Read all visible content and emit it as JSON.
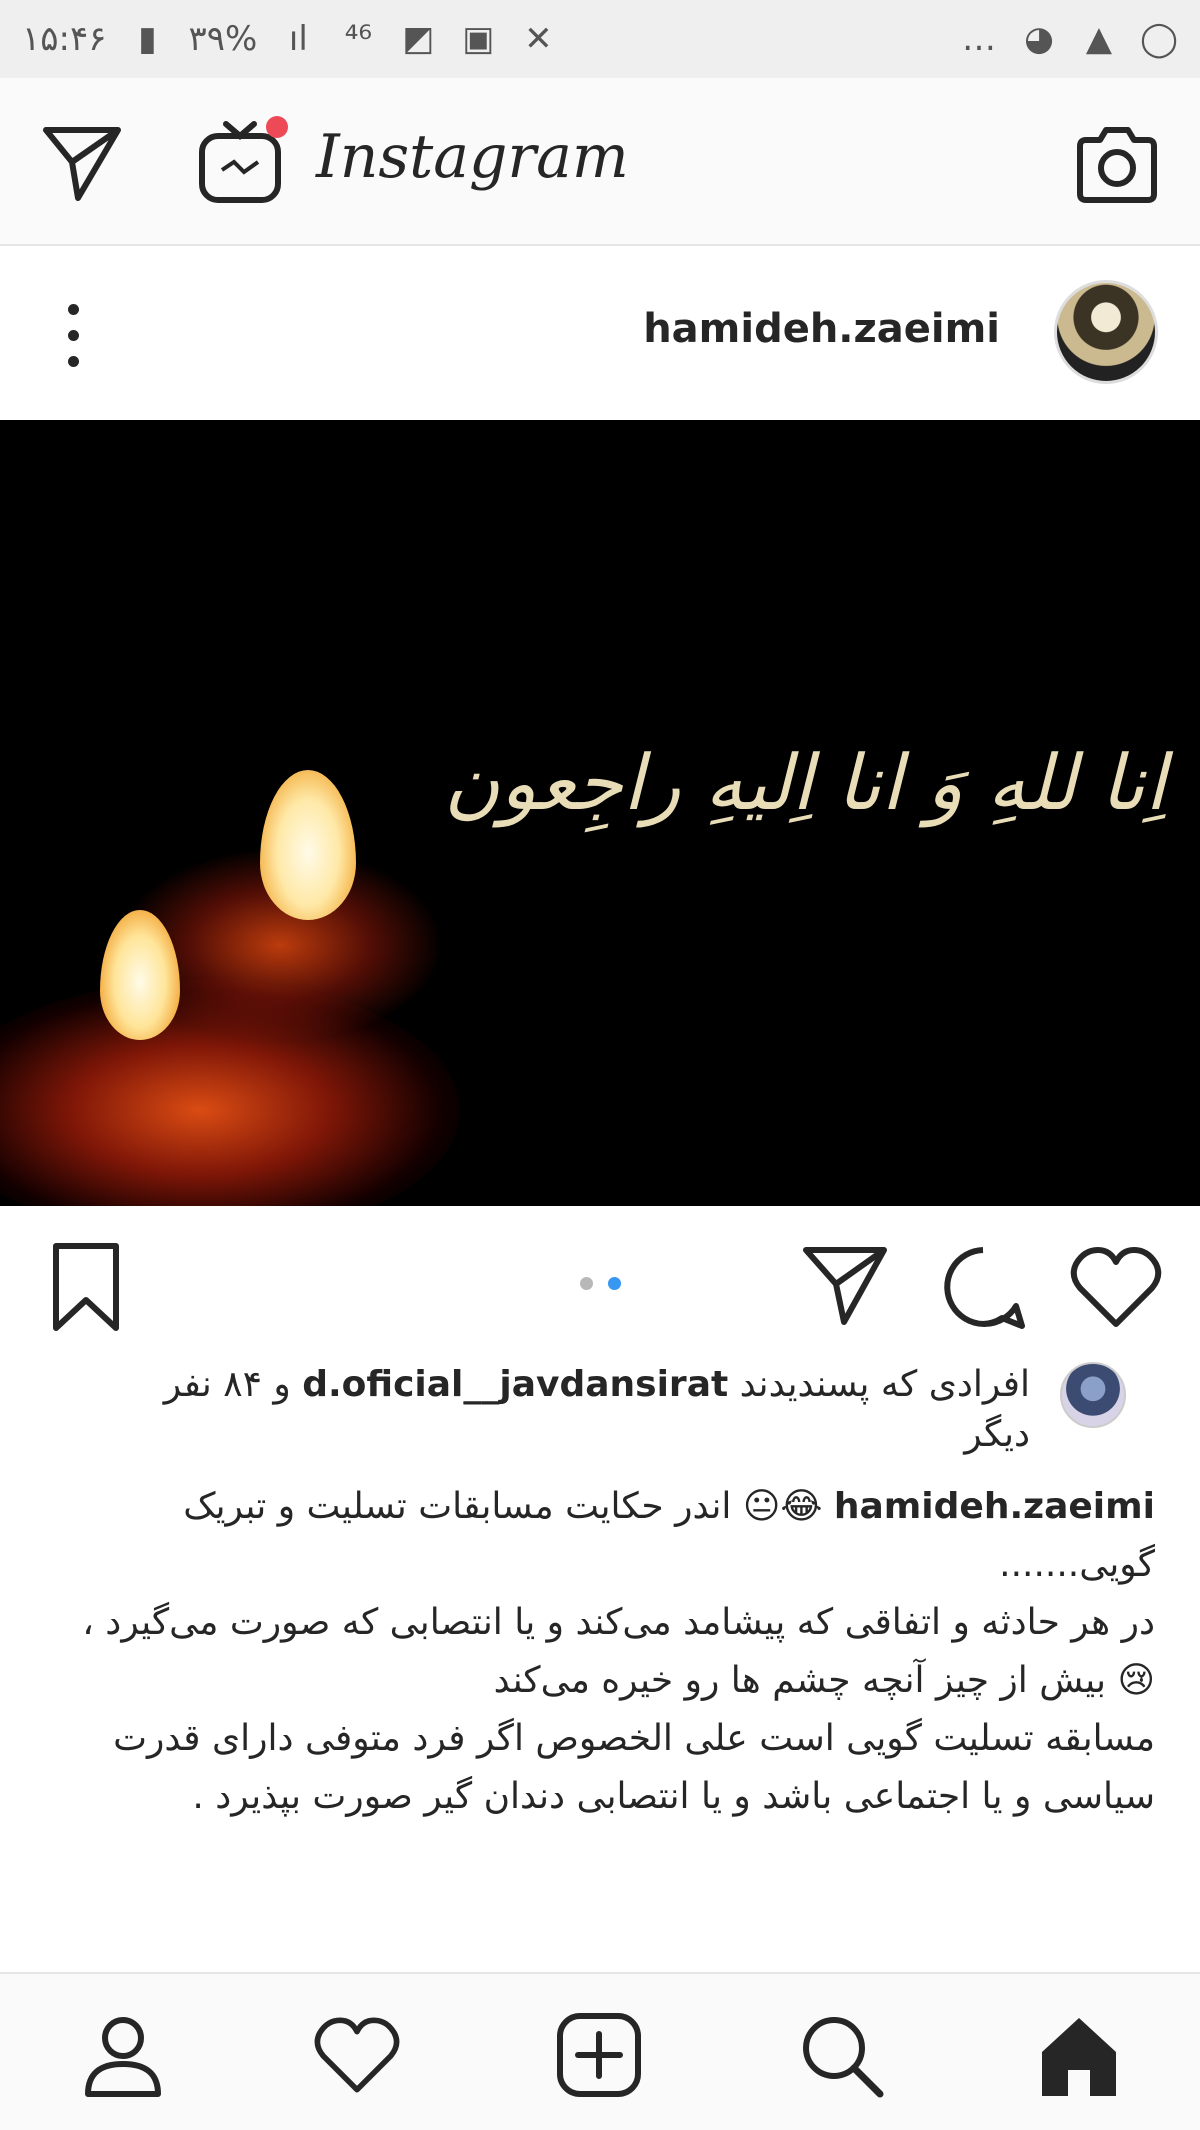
{
  "status_bar": {
    "time": "۱۵:۴۶",
    "battery": "۳۹%"
  },
  "app": {
    "logo_text": "Instagram"
  },
  "post": {
    "username": "hamideh.zaeimi",
    "image_text": "اِنا للهِ وَ انا اِلیهِ راجِعون",
    "likes": {
      "prefix": "افرادی که پسندیدند",
      "user": "d.oficial__javdansirat",
      "suffix": "و ۸۴ نفر دیگر"
    },
    "caption": {
      "user": "hamideh.zaeimi",
      "emoji": "😂😐",
      "line1": "اندر حکایت مسابقات تسلیت و تبریک گویی.......",
      "line2": "در هر حادثه و اتفاقی که پیشامد می‌کند و یا انتصابی که صورت می‌گیرد ،",
      "line3_emoji": "😢",
      "line3": "بیش از  چیز  آنچه چشم ها رو خیره می‌کند",
      "line4": "مسابقه تسلیت گویی است علی الخصوص اگر  فرد متوفی  دارای قدرت سیاسی و یا اجتماعی باشد و یا انتصابی  دندان گیر صورت بپذیرد ."
    }
  },
  "colors": {
    "notification": "#ed4956",
    "carousel_active": "#3897f0",
    "carousel_inactive": "#b8b8b8"
  },
  "icons": {
    "header": [
      "send-icon",
      "igtv-icon",
      "camera-icon"
    ],
    "actions": [
      "bookmark-icon",
      "share-icon",
      "comment-icon",
      "heart-icon"
    ],
    "bottom_nav": [
      "profile-icon",
      "activity-heart-icon",
      "new-post-icon",
      "search-icon",
      "home-icon"
    ]
  }
}
